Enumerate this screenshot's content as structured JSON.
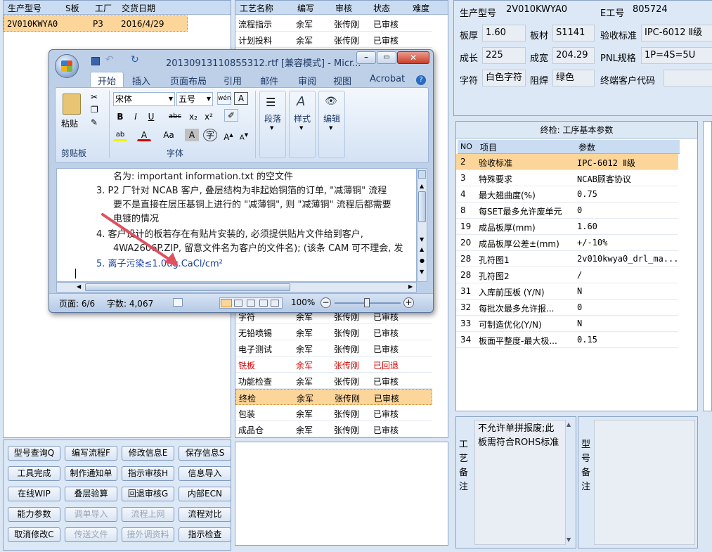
{
  "left_table": {
    "headers": [
      "生产型号",
      "S板",
      "工厂",
      "交货日期"
    ],
    "rows": [
      {
        "model": "2V010KWYA0",
        "s": "",
        "factory": "P3",
        "date": "2016/4/29"
      }
    ]
  },
  "process_table": {
    "headers": [
      "工艺名称",
      "编写",
      "审核",
      "状态",
      "难度"
    ],
    "rows": [
      {
        "name": "流程指示",
        "writer": "余军",
        "reviewer": "张传刚",
        "status": "已审核",
        "red": false,
        "selected": false
      },
      {
        "name": "计划投料",
        "writer": "余军",
        "reviewer": "张传刚",
        "status": "已审核",
        "red": false,
        "selected": false
      },
      {
        "name": "字符",
        "writer": "余军",
        "reviewer": "张传刚",
        "status": "已审核",
        "red": false,
        "selected": false
      },
      {
        "name": "无铅喷锡",
        "writer": "余军",
        "reviewer": "张传刚",
        "status": "已审核",
        "red": false,
        "selected": false
      },
      {
        "name": "电子测试",
        "writer": "余军",
        "reviewer": "张传刚",
        "status": "已审核",
        "red": false,
        "selected": false
      },
      {
        "name": "铣板",
        "writer": "余军",
        "reviewer": "张传刚",
        "status": "已回退",
        "red": true,
        "selected": false
      },
      {
        "name": "功能检查",
        "writer": "余军",
        "reviewer": "张传刚",
        "status": "已审核",
        "red": false,
        "selected": false
      },
      {
        "name": "终检",
        "writer": "余军",
        "reviewer": "张传刚",
        "status": "已审核",
        "red": false,
        "selected": true
      },
      {
        "name": "包装",
        "writer": "余军",
        "reviewer": "张传刚",
        "status": "已审核",
        "red": false,
        "selected": false
      },
      {
        "name": "成品仓",
        "writer": "余军",
        "reviewer": "张传刚",
        "status": "已审核",
        "red": false,
        "selected": false
      }
    ]
  },
  "buttons": [
    [
      "型号查询Q",
      "编写流程F",
      "修改信息E",
      "保存信息S"
    ],
    [
      "工具完成",
      "制作通知单",
      "指示审核H",
      "信息导入"
    ],
    [
      "在线WIP",
      "叠层验算",
      "回退审核G",
      "内部ECN"
    ],
    [
      "能力参数",
      "调单导入",
      "流程上网",
      "流程对比"
    ],
    [
      "取消修改C",
      "传送文件",
      "接外调资料",
      "指示检查"
    ]
  ],
  "disabled_buttons": [
    "调单导入",
    "流程上网",
    "传送文件",
    "接外调资料"
  ],
  "info": {
    "model_lbl": "生产型号",
    "model": "2V010KWYA0",
    "eno_lbl": "E工号",
    "eno": "805724",
    "thick_lbl": "板厚",
    "thick": "1.60",
    "material_lbl": "板材",
    "material": "S1141",
    "std_lbl": "验收标准",
    "std": "IPC-6012 Ⅱ级",
    "len_lbl": "成长",
    "len": "225",
    "width_lbl": "成宽",
    "width": "204.29",
    "pnl_lbl": "PNL规格",
    "pnl": "1P=4S=5U",
    "char_lbl": "字符",
    "char": "白色字符",
    "mask_lbl": "阻焊",
    "mask": "绿色",
    "cust_lbl": "终端客户代码",
    "cust": ""
  },
  "params": {
    "title": "终检: 工序基本参数",
    "headers": [
      "NO",
      "项目",
      "参数"
    ],
    "rows": [
      {
        "no": "2",
        "item": "验收标准",
        "value": "IPC-6012 Ⅱ级"
      },
      {
        "no": "3",
        "item": "特殊要求",
        "value": "NCAB顾客协议"
      },
      {
        "no": "4",
        "item": "最大翘曲度(%)",
        "value": "0.75"
      },
      {
        "no": "8",
        "item": "每SET最多允许废单元",
        "value": "0"
      },
      {
        "no": "19",
        "item": "成品板厚(mm)",
        "value": "1.60"
      },
      {
        "no": "20",
        "item": "成品板厚公差±(mm)",
        "value": "+/-10%"
      },
      {
        "no": "28",
        "item": "孔符图1",
        "value": "2v010kwya0_drl_ma..."
      },
      {
        "no": "28",
        "item": "孔符图2",
        "value": "/"
      },
      {
        "no": "31",
        "item": "入库前压板 (Y/N)",
        "value": "N"
      },
      {
        "no": "32",
        "item": "每批次最多允许报...",
        "value": "0"
      },
      {
        "no": "33",
        "item": "可制造优化(Y/N)",
        "value": "N"
      },
      {
        "no": "34",
        "item": "板面平整度-最大极...",
        "value": "0.15"
      }
    ]
  },
  "remarks": {
    "process_lbl": "工艺备注",
    "process_text": "不允许单拼报废;此板需符合ROHS标准",
    "model_lbl": "型号备注",
    "model_text": ""
  },
  "word": {
    "title": "20130913110855312.rtf [兼容模式] - Micr...",
    "tabs": [
      "开始",
      "插入",
      "页面布局",
      "引用",
      "邮件",
      "审阅",
      "视图",
      "Acrobat"
    ],
    "font": "宋体",
    "size": "五号",
    "groups": {
      "clipboard": "剪贴板",
      "font": "字体",
      "paragraph": "段落",
      "styles": "样式",
      "editing": "编辑",
      "paste": "粘贴"
    },
    "lines": [
      "名为: important information.txt 的空文件",
      "3.  P2 厂针对 NCAB 客户, 叠层结构为非起始铜箔的订单, \"减薄铜\" 流程",
      "要不是直接在层压基铜上进行的 \"减薄铜\", 则 \"减薄铜\" 流程后都需要",
      "电镀的情况",
      "4.  客户设计的板若存在有贴片安装的, 必须提供贴片文件给到客户,",
      "4WA2606P.ZIP, 留意文件名为客户的文件名); (该条 CAM 可不理会, 发",
      "5.  离子污染≤1.0ug.CaCl/cm²"
    ],
    "status_page": "页面: 6/6",
    "status_words": "字数: 4,067",
    "zoom": "100%"
  }
}
